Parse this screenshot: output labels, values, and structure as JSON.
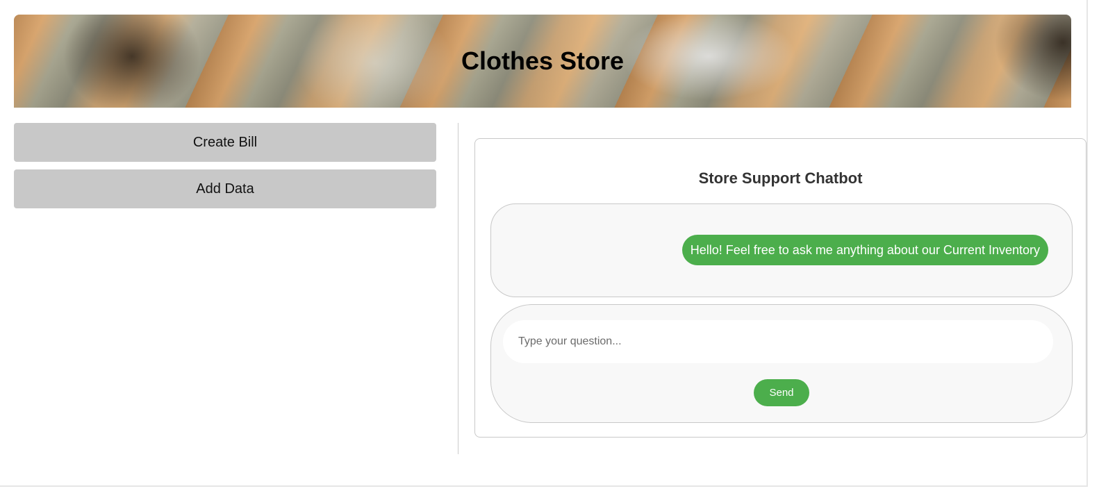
{
  "header": {
    "title": "Clothes Store"
  },
  "sidebar": {
    "buttons": [
      {
        "label": "Create Bill"
      },
      {
        "label": "Add Data"
      }
    ]
  },
  "chatbot": {
    "title": "Store Support Chatbot",
    "messages": [
      {
        "sender": "bot",
        "text": "Hello! Feel free to ask me anything about our Current Inventory"
      }
    ],
    "input": {
      "value": "",
      "placeholder": "Type your question..."
    },
    "send_label": "Send"
  },
  "colors": {
    "accent_green": "#4cae4c",
    "sidebar_button_bg": "#c8c8c8",
    "panel_bg": "#f8f8f8"
  }
}
